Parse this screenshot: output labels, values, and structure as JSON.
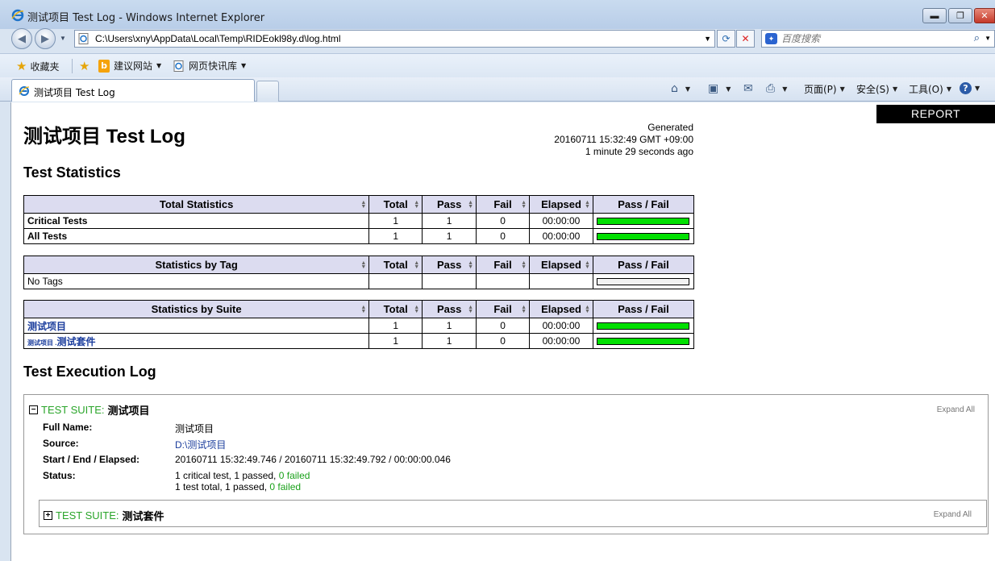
{
  "window": {
    "title": "测试项目 Test Log - Windows Internet Explorer",
    "minimize": "▬",
    "maximize": "❐",
    "close": "✕"
  },
  "nav": {
    "address": "C:\\Users\\xny\\AppData\\Local\\Temp\\RIDEokl98y.d\\log.html",
    "search_placeholder": "百度搜索"
  },
  "favorites": {
    "fav_label": "收藏夹",
    "suggested": "建议网站",
    "webslice": "网页快讯库"
  },
  "tab": {
    "label": "测试项目 Test Log"
  },
  "commands": {
    "page": "页面(P)",
    "safety": "安全(S)",
    "tools": "工具(O)"
  },
  "page": {
    "report_button": "REPORT",
    "title": "测试项目 Test Log",
    "generated_label": "Generated",
    "generated_time": "20160711 15:32:49 GMT +09:00",
    "generated_ago": "1 minute 29 seconds ago",
    "stats_heading": "Test Statistics",
    "exec_heading": "Test Execution Log"
  },
  "columns": {
    "total": "Total",
    "pass": "Pass",
    "fail": "Fail",
    "elapsed": "Elapsed",
    "pass_fail": "Pass / Fail"
  },
  "total_stats": {
    "header": "Total Statistics",
    "rows": [
      {
        "name": "Critical Tests",
        "total": "1",
        "pass": "1",
        "fail": "0",
        "elapsed": "00:00:00"
      },
      {
        "name": "All Tests",
        "total": "1",
        "pass": "1",
        "fail": "0",
        "elapsed": "00:00:00"
      }
    ]
  },
  "tag_stats": {
    "header": "Statistics by Tag",
    "rows": [
      {
        "name": "No Tags"
      }
    ]
  },
  "suite_stats": {
    "header": "Statistics by Suite",
    "rows": [
      {
        "name": "测试项目",
        "total": "1",
        "pass": "1",
        "fail": "0",
        "elapsed": "00:00:00"
      },
      {
        "prefix": "测试项目 .",
        "name": "测试套件",
        "total": "1",
        "pass": "1",
        "fail": "0",
        "elapsed": "00:00:00"
      }
    ]
  },
  "suite": {
    "toggle": "−",
    "label": "TEST SUITE:",
    "name": "测试项目",
    "expand_all": "Expand All",
    "full_name_key": "Full Name:",
    "full_name": "测试项目",
    "source_key": "Source:",
    "source": "D:\\测试项目",
    "times_key": "Start / End / Elapsed:",
    "times": "20160711 15:32:49.746 / 20160711 15:32:49.792 / 00:00:00.046",
    "status_key": "Status:",
    "status_line1": "1 critical test, 1 passed, ",
    "status_line1_failed": "0 failed",
    "status_line2": "1 test total, 1 passed, ",
    "status_line2_failed": "0 failed"
  },
  "child_suite": {
    "toggle": "+",
    "label": "TEST SUITE:",
    "name": "测试套件",
    "expand_all": "Expand All"
  },
  "colors": {
    "pass_bar": "#00e000",
    "header_bg": "#dcdcf0",
    "suite_label": "#2aa52a"
  }
}
